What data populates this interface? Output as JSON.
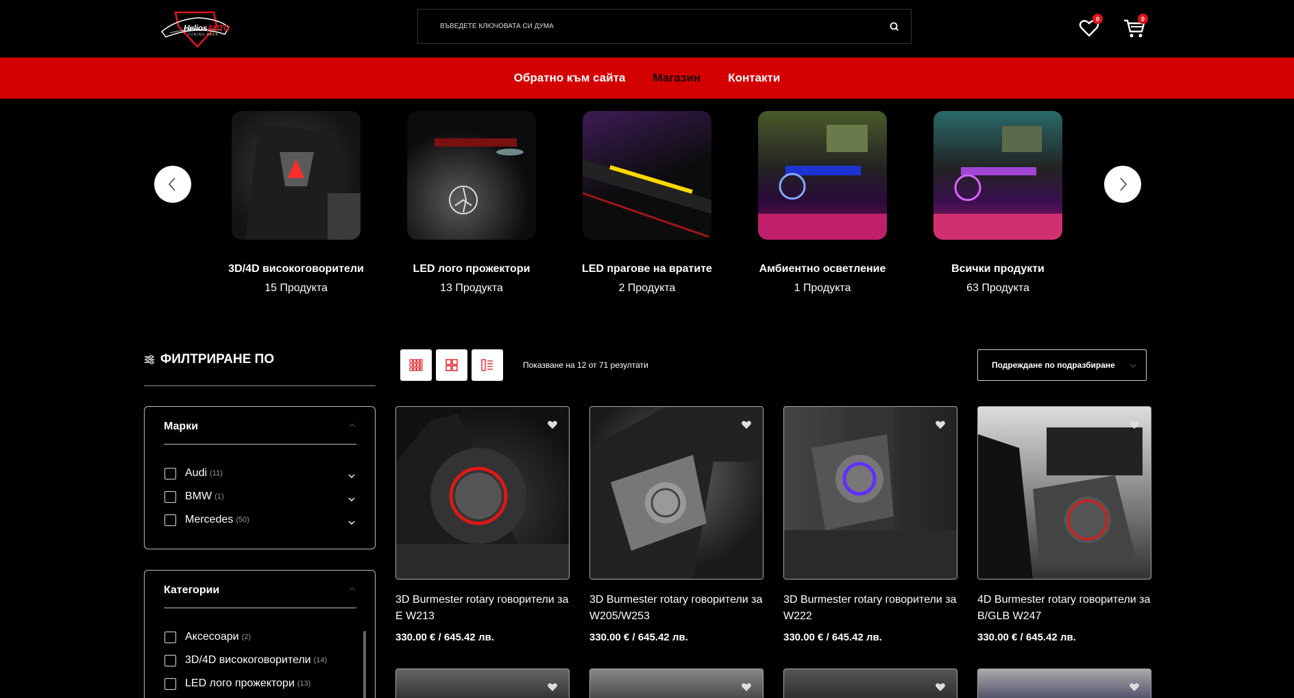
{
  "brand": {
    "name_part1": "Helios",
    "name_part2": "AUTO",
    "tagline": "TUNING PARK",
    "accent": "#e0141b"
  },
  "search": {
    "placeholder": "ВЪВЕДЕТЕ КЛЮЧОВАТА СИ ДУМА",
    "icon": "search-icon"
  },
  "header": {
    "wishlist_count": "0",
    "cart_count": "0"
  },
  "nav": {
    "items": [
      {
        "label": "Обратно към сайта"
      },
      {
        "label": "Магазин"
      },
      {
        "label": "Контакти"
      }
    ],
    "bg": "#d40000"
  },
  "categories": [
    {
      "title": "3D/4D високоговорители",
      "count": "15 Продукта"
    },
    {
      "title": "LED лого прожектори",
      "count": "13 Продукта"
    },
    {
      "title": "LED прагове на вратите",
      "count": "2 Продукта"
    },
    {
      "title": "Амбиентно осветление",
      "count": "1 Продукта"
    },
    {
      "title": "Всички продукти",
      "count": "63 Продукта"
    }
  ],
  "sidebar": {
    "filter_title": "ФИЛТРИРАНЕ ПО",
    "brands": {
      "title": "Марки",
      "options": [
        {
          "label": "Audi",
          "count": "(11)"
        },
        {
          "label": "BMW",
          "count": "(1)"
        },
        {
          "label": "Mercedes",
          "count": "(50)"
        }
      ]
    },
    "categories": {
      "title": "Категории",
      "options": [
        {
          "label": "Аксесоари",
          "count": "(2)"
        },
        {
          "label": "3D/4D високоговорители",
          "count": "(14)"
        },
        {
          "label": "LED лого прожектори",
          "count": "(13)"
        }
      ]
    }
  },
  "toolbar": {
    "results": "Показване на 12 от 71 резултати",
    "sort": "Подреждане по подразбиране"
  },
  "products": [
    {
      "title": "3D Burmester rotary говорители за E W213",
      "price": "330.00 € / 645.42 лв."
    },
    {
      "title": "3D Burmester rotary говорители за W205/W253",
      "price": "330.00 € / 645.42 лв."
    },
    {
      "title": "3D Burmester rotary говорители за W222",
      "price": "330.00 € / 645.42 лв."
    },
    {
      "title": "4D Burmester rotary говорители за B/GLB W247",
      "price": "330.00 € / 645.42 лв."
    }
  ]
}
